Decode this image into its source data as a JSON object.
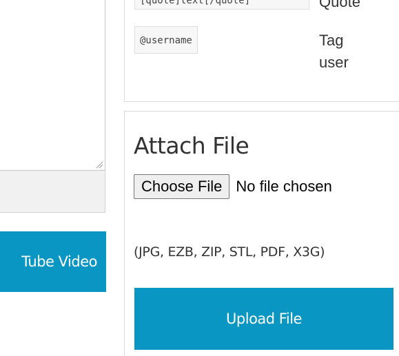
{
  "editor": {
    "video_button_label": "Tube Video"
  },
  "markup_help": {
    "items": [
      {
        "code": "[quote]text[/quote]",
        "description": "Quote"
      },
      {
        "code": "@username",
        "description": "Tag user"
      }
    ]
  },
  "attach": {
    "title": "Attach File",
    "choose_button_label": "Choose File",
    "file_status": "No file chosen",
    "allowed_formats": "(JPG, EZB, ZIP, STL, PDF, X3G)",
    "upload_button_label": "Upload File"
  },
  "colors": {
    "accent": "#0996c3",
    "toolbar_bg": "#f1f1f1",
    "chip_bg": "#f7f7f7"
  }
}
